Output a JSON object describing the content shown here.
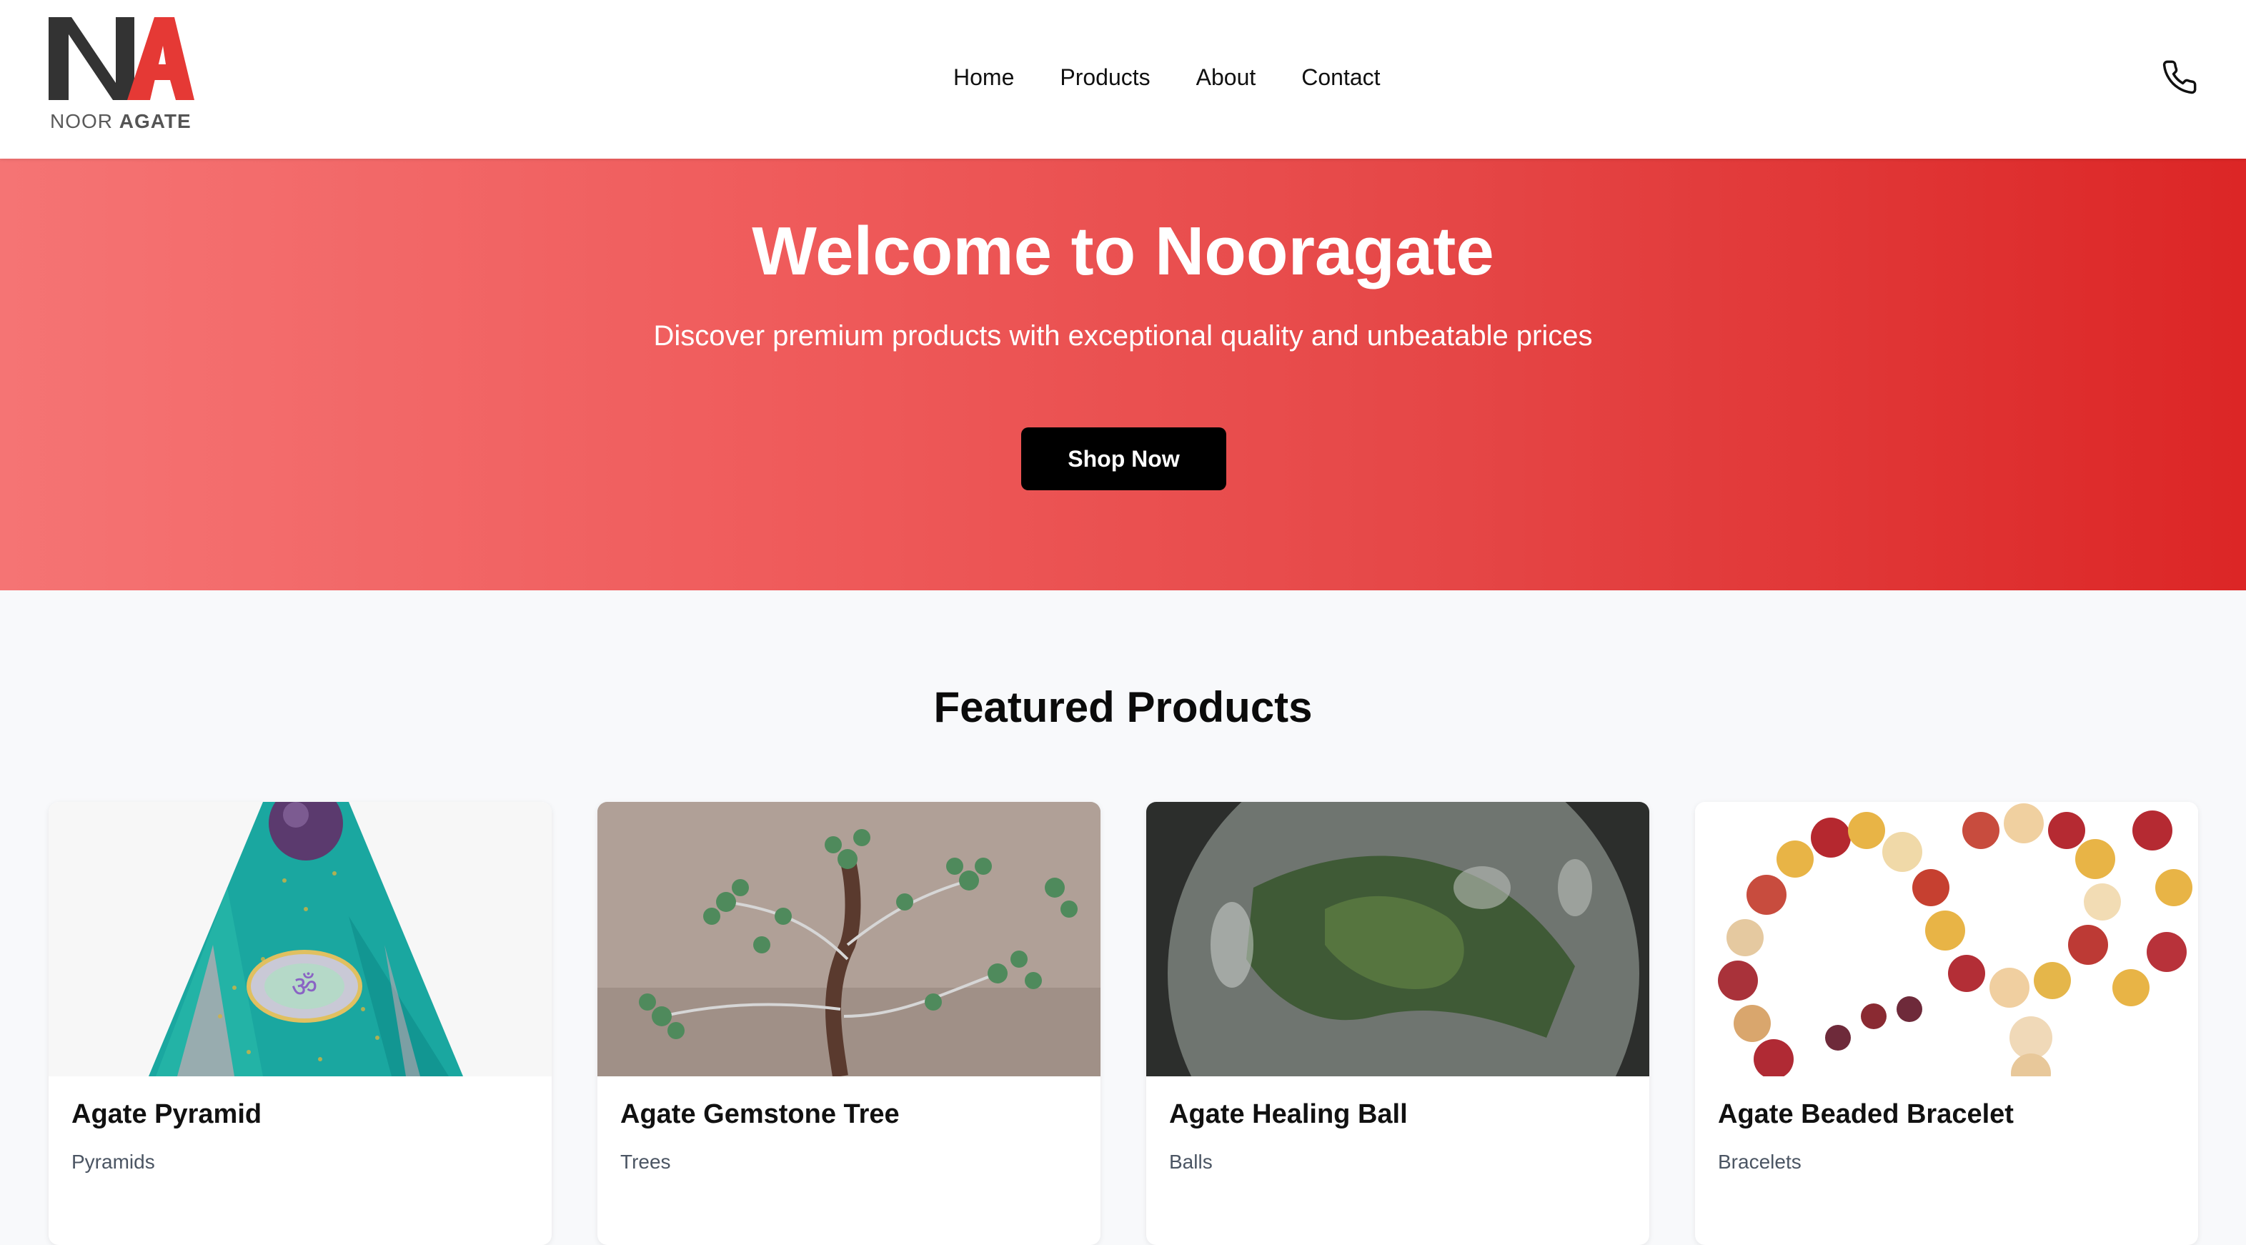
{
  "brand": {
    "logo_letters": "NA",
    "logo_word1": "NOOR",
    "logo_word2": "AGATE"
  },
  "nav": [
    {
      "label": "Home"
    },
    {
      "label": "Products"
    },
    {
      "label": "About"
    },
    {
      "label": "Contact"
    }
  ],
  "header_icons": {
    "phone": "phone-icon"
  },
  "hero": {
    "title": "Welcome to Nooragate",
    "subtitle": "Discover premium products with exceptional quality and unbeatable prices",
    "cta_label": "Shop Now"
  },
  "featured": {
    "title": "Featured Products",
    "products": [
      {
        "name": "Agate Pyramid",
        "category": "Pyramids",
        "image": "orgonite-pyramid-image"
      },
      {
        "name": "Agate Gemstone Tree",
        "category": "Trees",
        "image": "gemstone-tree-image"
      },
      {
        "name": "Agate Healing Ball",
        "category": "Balls",
        "image": "moss-agate-sphere-image"
      },
      {
        "name": "Agate Beaded Bracelet",
        "category": "Bracelets",
        "image": "beaded-bracelet-image"
      }
    ]
  },
  "colors": {
    "hero_gradient_start": "#f57474",
    "hero_gradient_end": "#dc2626",
    "logo_dark": "#333333",
    "logo_red": "#e53935",
    "cta_bg": "#000000"
  }
}
